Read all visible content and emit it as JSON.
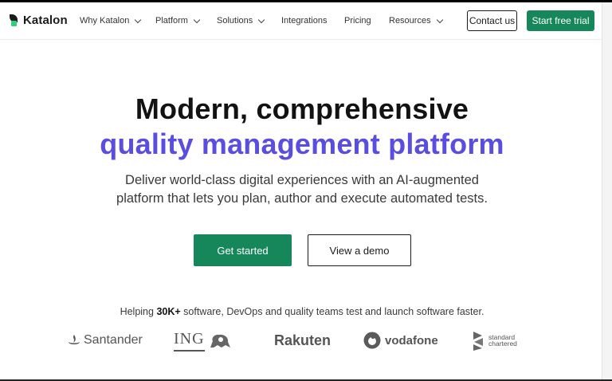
{
  "header": {
    "logo_text": "Katalon",
    "nav": [
      {
        "label": "Why Katalon",
        "has_dropdown": true
      },
      {
        "label": "Platform",
        "has_dropdown": true
      },
      {
        "label": "Solutions",
        "has_dropdown": true
      },
      {
        "label": "Integrations",
        "has_dropdown": false
      },
      {
        "label": "Pricing",
        "has_dropdown": false
      },
      {
        "label": "Resources",
        "has_dropdown": true
      }
    ],
    "contact_label": "Contact us",
    "trial_label": "Start free trial"
  },
  "hero": {
    "title_line1": "Modern, comprehensive",
    "title_line2": "quality management platform",
    "subtitle_line1": "Deliver world-class digital experiences with an AI-augmented",
    "subtitle_line2": "platform that lets you plan, author and execute automated tests.",
    "primary_cta": "Get started",
    "secondary_cta": "View a demo"
  },
  "trust": {
    "prefix": "Helping ",
    "highlight": "30K+",
    "suffix": " software, DevOps and quality teams test and launch software faster.",
    "logos": {
      "santander": "Santander",
      "ing": "ING",
      "rakuten": "Rakuten",
      "vodafone": "vodafone",
      "sc_line1": "standard",
      "sc_line2": "chartered"
    }
  },
  "colors": {
    "brand_green": "#16875b",
    "accent_purple": "#5a4ee0",
    "logo_green": "#2fd07a"
  }
}
